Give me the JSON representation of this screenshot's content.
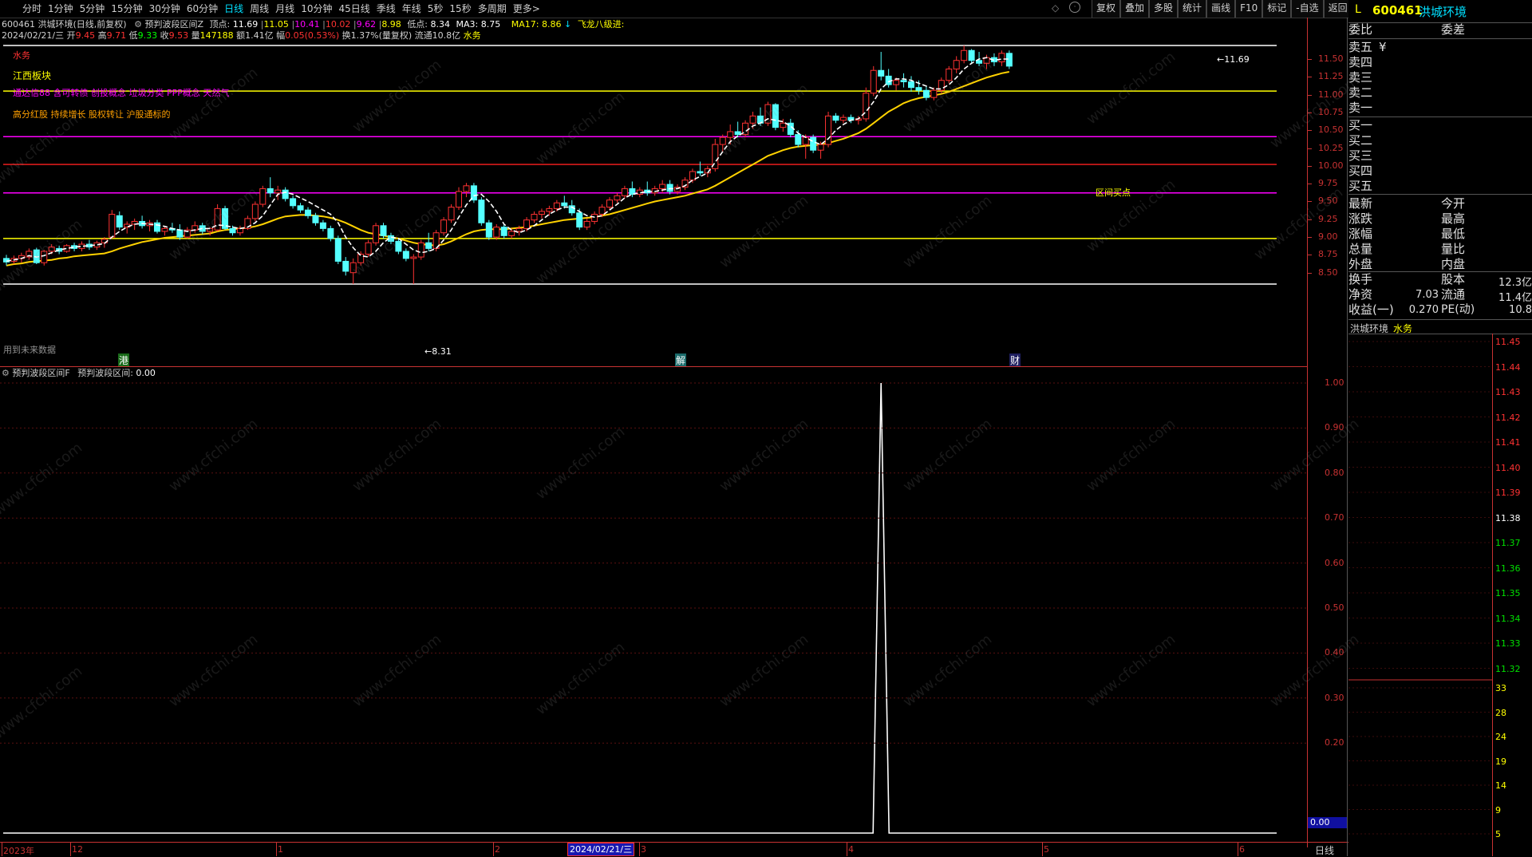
{
  "period_tabs": [
    "分时",
    "1分钟",
    "5分钟",
    "15分钟",
    "30分钟",
    "60分钟",
    "日线",
    "周线",
    "月线",
    "10分钟",
    "45日线",
    "季线",
    "年线",
    "5秒",
    "15秒",
    "多周期",
    "更多>"
  ],
  "active_tab": "日线",
  "right_buttons": [
    "复权",
    "叠加",
    "多股",
    "统计",
    "画线",
    "F10",
    "标记",
    "-自选",
    "返回"
  ],
  "info1": {
    "code_name": "600461 洪城环境(日线,前复权)",
    "indicator": "预判波段区间Z",
    "top_label": "顶点:",
    "top_val": "11.69",
    "v1": "11.05",
    "v2": "10.41",
    "v3": "10.02",
    "v4": "9.62",
    "v5": "8.98",
    "low_label": "低点:",
    "low_val": "8.34",
    "ma3": "MA3: 8.75",
    "ma17": "MA17: 8.86",
    "signal": "飞龙八级进:"
  },
  "info2": {
    "date": "2024/02/21/三",
    "open_l": "开",
    "open": "9.45",
    "high_l": "高",
    "high": "9.71",
    "low_l": "低",
    "low": "9.33",
    "close_l": "收",
    "close": "9.53",
    "vol_l": "量",
    "vol": "147188",
    "amt_l": "额",
    "amt": "1.41亿",
    "chg_l": "幅",
    "chg": "0.05(0.53%)",
    "turn": "换1.37%(量复权)",
    "float": "流通10.8亿",
    "sector": "水务"
  },
  "overlay": {
    "sector_tag": "水务",
    "province": "江西板块",
    "concepts1": "通达信88 含可转债 创投概念 垃圾分类 PPP概念 天然气",
    "concepts2": "高分红股 持续增长 股权转让 沪股通标的",
    "buy_point": "区间买点",
    "top_mark": "11.69",
    "low_mark": "8.31",
    "future_data": "用到未来数据",
    "event1": "港",
    "event2": "解",
    "event3": "财"
  },
  "price_axis": [
    "11.50",
    "11.25",
    "11.00",
    "10.75",
    "10.50",
    "10.25",
    "10.00",
    "9.75",
    "9.50",
    "9.25",
    "9.00",
    "8.75",
    "8.50"
  ],
  "sub": {
    "title": "预判波段区间F",
    "param_label": "预判波段区间:",
    "param_val": "0.00",
    "axis": [
      "1.00",
      "0.90",
      "0.80",
      "0.70",
      "0.60",
      "0.50",
      "0.40",
      "0.30",
      "0.20"
    ],
    "current": "0.00"
  },
  "date_axis": {
    "items": [
      "2023年",
      "12",
      "1",
      "2",
      "3",
      "4",
      "5",
      "6"
    ],
    "cursor": "2024/02/21/三",
    "period": "日线"
  },
  "panel": {
    "flag": "L",
    "code": "600461",
    "name": "洪城环境",
    "weibi": "委比",
    "weicha": "委差",
    "asks": [
      "卖五",
      "卖四",
      "卖三",
      "卖二",
      "卖一"
    ],
    "ask5_suffix": "¥",
    "bids": [
      "买一",
      "买二",
      "买三",
      "买四",
      "买五"
    ],
    "left_labels": [
      "最新",
      "涨跌",
      "涨幅",
      "总量",
      "外盘"
    ],
    "right_labels": [
      "今开",
      "最高",
      "最低",
      "量比",
      "内盘"
    ],
    "huanshou": "换手",
    "guben": "股本",
    "guben_val": "12.3亿",
    "jingzi": "净资",
    "jingzi_val": "7.03",
    "liutong": "流通",
    "liutong_val": "11.4亿",
    "shouyi": "收益(一)",
    "shouyi_val": "0.270",
    "pe": "PE(动)",
    "pe_val": "10.8",
    "mini_name": "洪城环境",
    "mini_sector": "水务",
    "mini_prices": [
      "11.45",
      "11.44",
      "11.43",
      "11.42",
      "11.41",
      "11.40",
      "11.39",
      "11.38",
      "11.37",
      "11.36",
      "11.35",
      "11.34",
      "11.33",
      "11.32"
    ],
    "mini_vols": [
      "33",
      "28",
      "24",
      "19",
      "14",
      "9",
      "5"
    ]
  },
  "watermark": "www.cfchi.com",
  "colors": {
    "up": "#ff3232",
    "down": "#54ffff",
    "ma_fast": "#ffffff",
    "ma_slow": "#ffd200",
    "hline_yellow": "#ffff00",
    "hline_magenta": "#ff00ff",
    "hline_red": "#ff2020",
    "axis_red": "#c83232"
  },
  "chart_data": {
    "type": "candlestick",
    "ylim": [
      8.4,
      11.7
    ],
    "reference_lines": [
      11.69,
      11.05,
      10.41,
      10.02,
      9.62,
      8.98,
      8.34
    ],
    "candles": [
      [
        8.7,
        8.75,
        8.6,
        8.65
      ],
      [
        8.66,
        8.74,
        8.62,
        8.7
      ],
      [
        8.7,
        8.78,
        8.64,
        8.74
      ],
      [
        8.72,
        8.84,
        8.68,
        8.8
      ],
      [
        8.82,
        8.85,
        8.62,
        8.64
      ],
      [
        8.64,
        8.82,
        8.6,
        8.8
      ],
      [
        8.8,
        8.9,
        8.76,
        8.86
      ],
      [
        8.84,
        8.88,
        8.76,
        8.8
      ],
      [
        8.8,
        8.9,
        8.78,
        8.88
      ],
      [
        8.88,
        8.92,
        8.8,
        8.84
      ],
      [
        8.84,
        8.94,
        8.8,
        8.9
      ],
      [
        8.9,
        8.96,
        8.82,
        8.86
      ],
      [
        8.86,
        8.95,
        8.82,
        8.92
      ],
      [
        8.92,
        9.0,
        8.85,
        8.97
      ],
      [
        9.0,
        9.38,
        8.98,
        9.32
      ],
      [
        9.3,
        9.36,
        9.1,
        9.14
      ],
      [
        9.14,
        9.22,
        9.05,
        9.18
      ],
      [
        9.18,
        9.26,
        9.1,
        9.22
      ],
      [
        9.22,
        9.3,
        9.12,
        9.16
      ],
      [
        9.16,
        9.24,
        9.08,
        9.2
      ],
      [
        9.2,
        9.24,
        9.05,
        9.08
      ],
      [
        9.08,
        9.15,
        9.02,
        9.12
      ],
      [
        9.12,
        9.2,
        9.06,
        9.1
      ],
      [
        9.1,
        9.18,
        8.96,
        9.0
      ],
      [
        9.0,
        9.14,
        8.98,
        9.1
      ],
      [
        9.1,
        9.22,
        9.06,
        9.16
      ],
      [
        9.16,
        9.2,
        9.04,
        9.08
      ],
      [
        9.08,
        9.14,
        9.02,
        9.12
      ],
      [
        9.1,
        9.46,
        9.08,
        9.4
      ],
      [
        9.4,
        9.44,
        9.1,
        9.12
      ],
      [
        9.12,
        9.16,
        9.02,
        9.06
      ],
      [
        9.06,
        9.16,
        9.02,
        9.12
      ],
      [
        9.12,
        9.3,
        9.1,
        9.26
      ],
      [
        9.26,
        9.5,
        9.22,
        9.46
      ],
      [
        9.46,
        9.72,
        9.42,
        9.68
      ],
      [
        9.68,
        9.84,
        9.56,
        9.62
      ],
      [
        9.62,
        9.72,
        9.52,
        9.66
      ],
      [
        9.66,
        9.7,
        9.5,
        9.54
      ],
      [
        9.54,
        9.58,
        9.4,
        9.44
      ],
      [
        9.44,
        9.48,
        9.34,
        9.38
      ],
      [
        9.38,
        9.42,
        9.26,
        9.3
      ],
      [
        9.3,
        9.34,
        9.16,
        9.2
      ],
      [
        9.2,
        9.24,
        9.08,
        9.12
      ],
      [
        9.12,
        9.16,
        8.94,
        8.98
      ],
      [
        8.98,
        9.02,
        8.62,
        8.66
      ],
      [
        8.66,
        8.72,
        8.46,
        8.52
      ],
      [
        8.5,
        8.7,
        8.34,
        8.64
      ],
      [
        8.64,
        8.8,
        8.6,
        8.76
      ],
      [
        8.76,
        8.96,
        8.72,
        8.92
      ],
      [
        8.92,
        9.2,
        8.88,
        9.16
      ],
      [
        9.16,
        9.2,
        8.98,
        9.02
      ],
      [
        9.02,
        9.06,
        8.9,
        8.94
      ],
      [
        8.94,
        8.98,
        8.76,
        8.8
      ],
      [
        8.8,
        8.84,
        8.66,
        8.7
      ],
      [
        8.7,
        8.76,
        8.34,
        8.72
      ],
      [
        8.72,
        8.96,
        8.68,
        8.92
      ],
      [
        8.92,
        9.06,
        8.8,
        8.84
      ],
      [
        8.84,
        9.1,
        8.8,
        9.06
      ],
      [
        9.06,
        9.28,
        9.02,
        9.24
      ],
      [
        9.24,
        9.46,
        9.2,
        9.42
      ],
      [
        9.42,
        9.7,
        9.38,
        9.64
      ],
      [
        9.64,
        9.76,
        9.56,
        9.72
      ],
      [
        9.72,
        9.76,
        9.48,
        9.52
      ],
      [
        9.52,
        9.56,
        9.16,
        9.2
      ],
      [
        9.2,
        9.24,
        8.96,
        9.0
      ],
      [
        9.0,
        9.18,
        8.96,
        9.14
      ],
      [
        9.14,
        9.18,
        8.98,
        9.02
      ],
      [
        9.02,
        9.12,
        8.98,
        9.08
      ],
      [
        9.08,
        9.16,
        9.02,
        9.12
      ],
      [
        9.12,
        9.28,
        9.08,
        9.24
      ],
      [
        9.24,
        9.36,
        9.2,
        9.32
      ],
      [
        9.32,
        9.4,
        9.26,
        9.36
      ],
      [
        9.36,
        9.44,
        9.3,
        9.4
      ],
      [
        9.4,
        9.52,
        9.36,
        9.48
      ],
      [
        9.48,
        9.58,
        9.4,
        9.44
      ],
      [
        9.44,
        9.52,
        9.3,
        9.34
      ],
      [
        9.34,
        9.4,
        9.1,
        9.14
      ],
      [
        9.14,
        9.26,
        9.1,
        9.22
      ],
      [
        9.22,
        9.36,
        9.18,
        9.32
      ],
      [
        9.32,
        9.46,
        9.28,
        9.42
      ],
      [
        9.42,
        9.56,
        9.38,
        9.52
      ],
      [
        9.52,
        9.62,
        9.48,
        9.58
      ],
      [
        9.58,
        9.72,
        9.54,
        9.68
      ],
      [
        9.68,
        9.78,
        9.56,
        9.6
      ],
      [
        9.6,
        9.7,
        9.56,
        9.66
      ],
      [
        9.66,
        9.78,
        9.58,
        9.62
      ],
      [
        9.62,
        9.72,
        9.58,
        9.68
      ],
      [
        9.68,
        9.8,
        9.62,
        9.74
      ],
      [
        9.74,
        9.8,
        9.6,
        9.64
      ],
      [
        9.64,
        9.74,
        9.6,
        9.7
      ],
      [
        9.7,
        9.84,
        9.66,
        9.8
      ],
      [
        9.8,
        9.96,
        9.76,
        9.92
      ],
      [
        9.92,
        10.06,
        9.86,
        9.9
      ],
      [
        9.9,
        10.0,
        9.84,
        9.96
      ],
      [
        9.96,
        10.38,
        9.92,
        10.3
      ],
      [
        10.3,
        10.44,
        10.2,
        10.4
      ],
      [
        10.4,
        10.58,
        10.3,
        10.48
      ],
      [
        10.48,
        10.62,
        10.4,
        10.44
      ],
      [
        10.44,
        10.64,
        10.4,
        10.6
      ],
      [
        10.6,
        10.76,
        10.52,
        10.7
      ],
      [
        10.7,
        10.82,
        10.56,
        10.6
      ],
      [
        10.6,
        10.9,
        10.56,
        10.86
      ],
      [
        10.86,
        10.88,
        10.5,
        10.54
      ],
      [
        10.54,
        10.66,
        10.48,
        10.6
      ],
      [
        10.6,
        10.66,
        10.4,
        10.44
      ],
      [
        10.44,
        10.5,
        10.26,
        10.3
      ],
      [
        10.3,
        10.44,
        10.1,
        10.4
      ],
      [
        10.4,
        10.44,
        10.18,
        10.22
      ],
      [
        10.22,
        10.34,
        10.1,
        10.3
      ],
      [
        10.3,
        10.76,
        10.26,
        10.7
      ],
      [
        10.7,
        10.74,
        10.6,
        10.64
      ],
      [
        10.64,
        10.72,
        10.6,
        10.68
      ],
      [
        10.68,
        10.72,
        10.6,
        10.64
      ],
      [
        10.64,
        10.7,
        10.58,
        10.66
      ],
      [
        10.66,
        11.1,
        10.62,
        11.02
      ],
      [
        11.02,
        11.4,
        10.98,
        11.34
      ],
      [
        11.34,
        11.6,
        11.2,
        11.26
      ],
      [
        11.26,
        11.36,
        11.1,
        11.14
      ],
      [
        11.14,
        11.24,
        11.06,
        11.2
      ],
      [
        11.2,
        11.3,
        11.1,
        11.18
      ],
      [
        11.18,
        11.26,
        11.04,
        11.1
      ],
      [
        11.1,
        11.2,
        11.0,
        11.06
      ],
      [
        11.06,
        11.12,
        10.92,
        10.96
      ],
      [
        10.96,
        11.1,
        10.92,
        11.06
      ],
      [
        11.06,
        11.24,
        11.02,
        11.2
      ],
      [
        11.2,
        11.4,
        11.16,
        11.36
      ],
      [
        11.36,
        11.54,
        11.3,
        11.48
      ],
      [
        11.48,
        11.69,
        11.44,
        11.62
      ],
      [
        11.62,
        11.64,
        11.44,
        11.48
      ],
      [
        11.48,
        11.6,
        11.4,
        11.44
      ],
      [
        11.44,
        11.56,
        11.36,
        11.52
      ],
      [
        11.52,
        11.58,
        11.4,
        11.46
      ],
      [
        11.46,
        11.62,
        11.4,
        11.58
      ],
      [
        11.58,
        11.62,
        11.36,
        11.4
      ]
    ],
    "ma_fast": [
      8.66,
      8.68,
      8.7,
      8.74,
      8.72,
      8.74,
      8.78,
      8.82,
      8.84,
      8.86,
      8.87,
      8.88,
      8.89,
      8.91,
      9.0,
      9.08,
      9.14,
      9.18,
      9.19,
      9.18,
      9.17,
      9.15,
      9.12,
      9.1,
      9.08,
      9.1,
      9.12,
      9.12,
      9.17,
      9.16,
      9.14,
      9.12,
      9.14,
      9.2,
      9.3,
      9.45,
      9.6,
      9.63,
      9.6,
      9.55,
      9.5,
      9.44,
      9.38,
      9.32,
      9.2,
      9.0,
      8.85,
      8.74,
      8.72,
      8.8,
      8.92,
      9.0,
      8.98,
      8.9,
      8.82,
      8.78,
      8.8,
      8.84,
      8.96,
      9.1,
      9.28,
      9.45,
      9.58,
      9.6,
      9.5,
      9.36,
      9.18,
      9.1,
      9.06,
      9.1,
      9.16,
      9.24,
      9.32,
      9.38,
      9.42,
      9.42,
      9.36,
      9.3,
      9.28,
      9.3,
      9.38,
      9.46,
      9.55,
      9.6,
      9.62,
      9.64,
      9.64,
      9.66,
      9.68,
      9.68,
      9.72,
      9.8,
      9.85,
      9.9,
      10.05,
      10.2,
      10.34,
      10.42,
      10.48,
      10.56,
      10.6,
      10.66,
      10.64,
      10.62,
      10.56,
      10.46,
      10.4,
      10.34,
      10.3,
      10.38,
      10.5,
      10.58,
      10.64,
      10.66,
      10.76,
      10.9,
      11.08,
      11.18,
      11.22,
      11.22,
      11.2,
      11.16,
      11.12,
      11.08,
      11.08,
      11.14,
      11.24,
      11.36,
      11.44,
      11.5,
      11.52,
      11.48,
      11.5,
      11.5
    ],
    "ma_slow": [
      8.6,
      8.62,
      8.63,
      8.65,
      8.66,
      8.67,
      8.68,
      8.7,
      8.71,
      8.73,
      8.74,
      8.75,
      8.76,
      8.77,
      8.8,
      8.84,
      8.87,
      8.9,
      8.93,
      8.95,
      8.97,
      8.99,
      9.0,
      9.01,
      9.02,
      9.03,
      9.04,
      9.05,
      9.08,
      9.1,
      9.11,
      9.12,
      9.13,
      9.15,
      9.18,
      9.22,
      9.26,
      9.29,
      9.3,
      9.31,
      9.31,
      9.3,
      9.29,
      9.27,
      9.24,
      9.2,
      9.15,
      9.1,
      9.06,
      9.04,
      9.02,
      9.0,
      8.98,
      8.95,
      8.92,
      8.9,
      8.89,
      8.88,
      8.9,
      8.94,
      8.99,
      9.04,
      9.08,
      9.1,
      9.11,
      9.11,
      9.11,
      9.12,
      9.13,
      9.14,
      9.16,
      9.18,
      9.2,
      9.22,
      9.24,
      9.25,
      9.26,
      9.27,
      9.28,
      9.3,
      9.32,
      9.35,
      9.38,
      9.41,
      9.44,
      9.47,
      9.5,
      9.52,
      9.54,
      9.56,
      9.58,
      9.61,
      9.64,
      9.67,
      9.72,
      9.78,
      9.84,
      9.9,
      9.96,
      10.02,
      10.08,
      10.14,
      10.18,
      10.22,
      10.25,
      10.27,
      10.28,
      10.29,
      10.3,
      10.32,
      10.35,
      10.38,
      10.42,
      10.46,
      10.52,
      10.6,
      10.68,
      10.76,
      10.82,
      10.88,
      10.92,
      10.95,
      10.97,
      10.99,
      11.01,
      11.04,
      11.08,
      11.12,
      11.16,
      11.2,
      11.24,
      11.27,
      11.3,
      11.32
    ],
    "sub_signal_index": 116
  }
}
